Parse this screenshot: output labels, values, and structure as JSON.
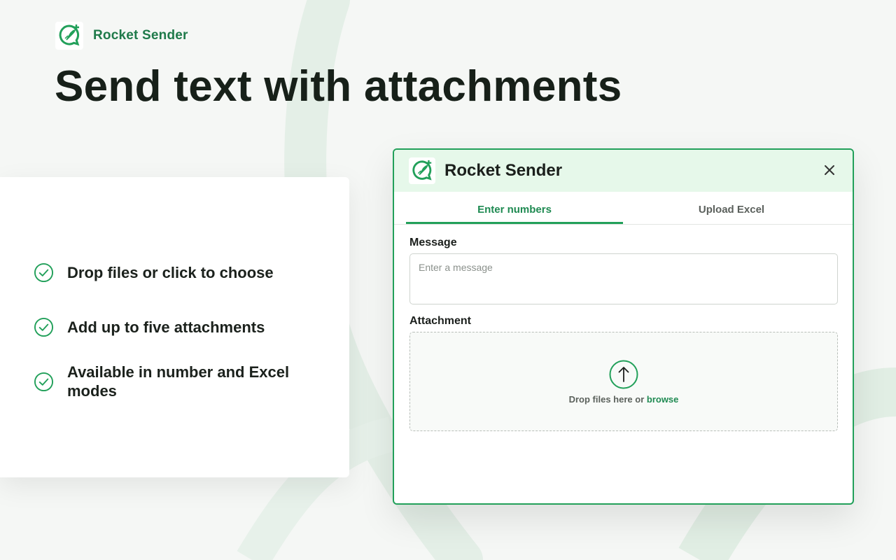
{
  "brand": {
    "name": "Rocket Sender",
    "logo_icon": "rocket-chat-plus-icon"
  },
  "headline": "Send text with attachments",
  "features": [
    {
      "text": "Drop files or click to choose",
      "icon": "check-circle-icon"
    },
    {
      "text": "Add up to five attachments",
      "icon": "check-circle-icon"
    },
    {
      "text": "Available in number and Excel modes",
      "icon": "check-circle-icon"
    }
  ],
  "dialog": {
    "title": "Rocket Sender",
    "close_icon": "close-icon",
    "tabs": [
      {
        "label": "Enter numbers",
        "active": true
      },
      {
        "label": "Upload Excel",
        "active": false
      }
    ],
    "message_label": "Message",
    "message_placeholder": "Enter a message",
    "attachment_label": "Attachment",
    "dropzone": {
      "icon": "upload-arrow-icon",
      "text": "Drop files here or",
      "browse": "browse"
    }
  },
  "colors": {
    "accent": "#22a05a",
    "accent_dark": "#1f7a4a",
    "header_bg": "#e6f8ea",
    "page_bg": "#f5f7f5"
  }
}
